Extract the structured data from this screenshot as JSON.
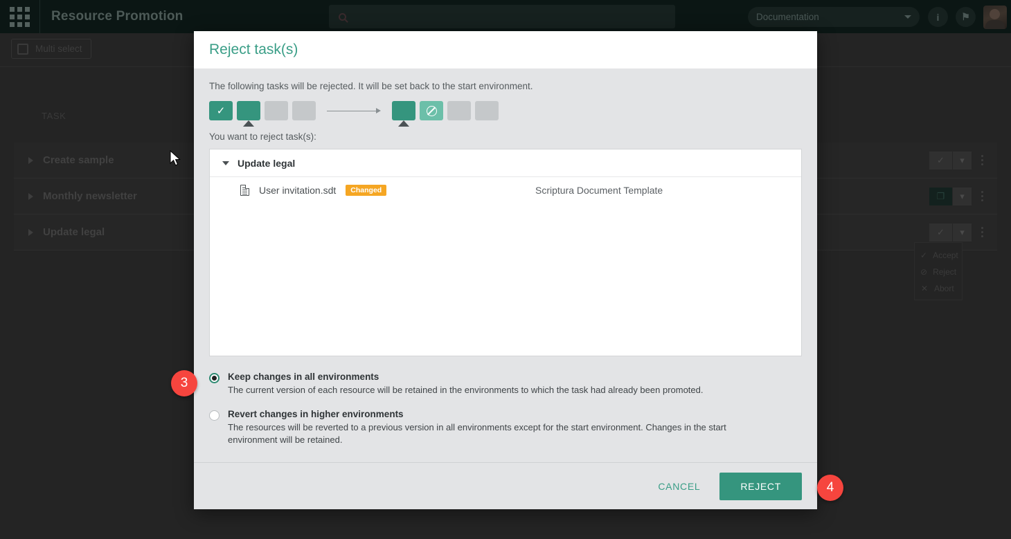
{
  "topbar": {
    "apps_icon": "grid-apps-icon",
    "app_title": "Resource Promotion",
    "search_placeholder": "",
    "search_icon": "search-icon",
    "doc_select_value": "Documentation",
    "doc_select_caret": "chevron-down-icon",
    "info_icon": "i",
    "bell_icon": "⚑",
    "avatar": "user-avatar"
  },
  "subbar": {
    "multi_select_label": "Multi select"
  },
  "table": {
    "column_task": "TASK",
    "rows": [
      {
        "name": "Create sample",
        "primary_action": "✓",
        "primary_style": "dark"
      },
      {
        "name": "Monthly newsletter",
        "primary_action": "❐",
        "primary_style": "green"
      },
      {
        "name": "Update legal",
        "primary_action": "✓",
        "primary_style": "dark"
      }
    ]
  },
  "context_menu": {
    "items": [
      {
        "icon": "check-icon",
        "glyph": "✓",
        "label": "Accept"
      },
      {
        "icon": "ban-icon",
        "glyph": "⊘",
        "label": "Reject"
      },
      {
        "icon": "close-icon",
        "glyph": "✕",
        "label": "Abort"
      }
    ]
  },
  "modal": {
    "title": "Reject task(s)",
    "description": "The following tasks will be rejected. It will be set back to the start environment.",
    "env_flow": {
      "left": [
        {
          "state": "filled",
          "glyph": "check",
          "marker": false
        },
        {
          "state": "filled",
          "glyph": "none",
          "marker": true
        },
        {
          "state": "empty",
          "glyph": "none",
          "marker": false
        },
        {
          "state": "empty",
          "glyph": "none",
          "marker": false
        }
      ],
      "right": [
        {
          "state": "filled",
          "glyph": "none",
          "marker": true
        },
        {
          "state": "light",
          "glyph": "ban",
          "marker": false
        },
        {
          "state": "empty",
          "glyph": "none",
          "marker": false
        },
        {
          "state": "empty",
          "glyph": "none",
          "marker": false
        }
      ]
    },
    "reject_prompt": "You want to reject task(s):",
    "task_group": {
      "name": "Update legal",
      "resources": [
        {
          "name": "User invitation.sdt",
          "badge": "Changed",
          "type": "Scriptura Document Template"
        }
      ]
    },
    "options": [
      {
        "selected": true,
        "title": "Keep changes in all environments",
        "description": "The current version of each resource will be retained in the environments to which the task had already been promoted."
      },
      {
        "selected": false,
        "title": "Revert changes in higher environments",
        "description": "The resources will be reverted to a previous version in all environments except for the start environment. Changes in the start environment will be retained."
      }
    ],
    "cancel_label": "CANCEL",
    "reject_label": "REJECT"
  },
  "step_badges": {
    "three": "3",
    "four": "4"
  },
  "colors": {
    "accent_green": "#35957e",
    "title_green": "#3a9e87",
    "badge_orange": "#f5a623",
    "step_red": "#f6453e",
    "modal_bg": "#e3e4e6",
    "topbar_bg": "#0b1614"
  }
}
